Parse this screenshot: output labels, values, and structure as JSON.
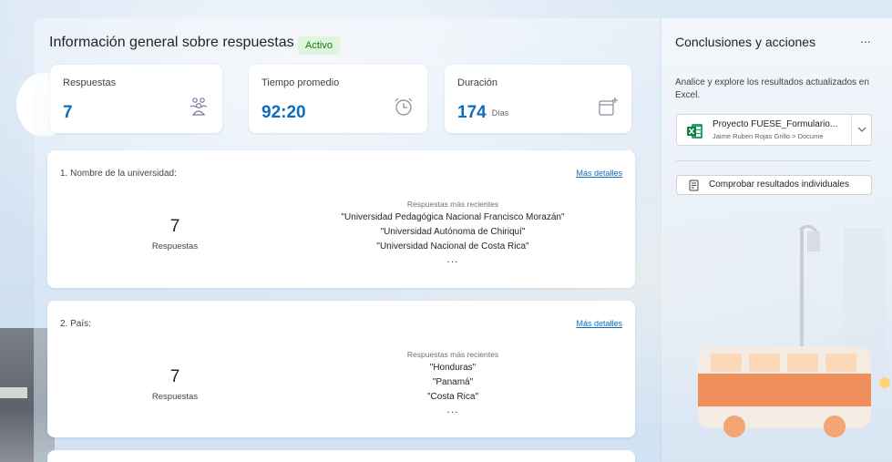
{
  "overview": {
    "title": "Información general sobre respuestas",
    "status": "Activo"
  },
  "stats": [
    {
      "label": "Respuestas",
      "value": "7",
      "unit": "",
      "icon": "users-icon"
    },
    {
      "label": "Tiempo promedio",
      "value": "92:20",
      "unit": "",
      "icon": "alarm-clock-icon"
    },
    {
      "label": "Duración",
      "value": "174",
      "unit": "Días",
      "icon": "calendar-add-icon"
    }
  ],
  "questions": [
    {
      "title": "1. Nombre de la universidad:",
      "more": "Más detalles",
      "count": "7",
      "count_label": "Respuestas",
      "recent_heading": "Respuestas más recientes",
      "recent": [
        "\"Universidad Pedagógica Nacional Francisco Morazán\"",
        "\"Universidad Autónoma de Chiriquí\"",
        "\"Universidad Nacional de Costa Rica\""
      ],
      "ellipsis": "..."
    },
    {
      "title": "2. País:",
      "more": "Más detalles",
      "count": "7",
      "count_label": "Respuestas",
      "recent_heading": "Respuestas más recientes",
      "recent": [
        "\"Honduras\"",
        "\"Panamá\"",
        "\"Costa Rica\""
      ],
      "ellipsis": "..."
    }
  ],
  "side": {
    "title": "Conclusiones y acciones",
    "more": "...",
    "description": "Analice y explore los resultados actualizados en Excel.",
    "file": {
      "name": "Proyecto FUESE_Formulario...",
      "path": "Jaime Ruben Rojas Grillo > Docume",
      "icon": "excel-icon"
    },
    "check_button": "Comprobar resultados individuales"
  },
  "colors": {
    "accent": "#0f6cbd",
    "badge_bg": "#dff6dd",
    "badge_fg": "#107c10",
    "excel_green": "#107c41"
  }
}
